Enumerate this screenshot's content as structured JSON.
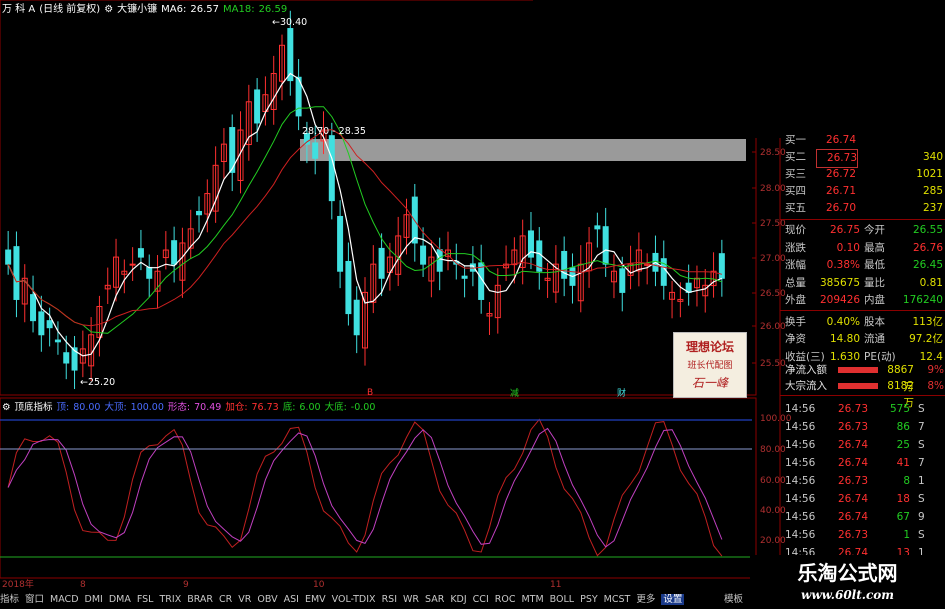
{
  "title_bar": {
    "stock": "万 科 A",
    "period": "(日线 前复权)",
    "indicator_name": "大镰小镰",
    "ma6_label": "MA6:",
    "ma6_value": "26.57",
    "ma18_label": "MA18:",
    "ma18_value": "26.59"
  },
  "price_annotations": {
    "high": "30.40",
    "low": "25.20",
    "range": "28.70 - 28.35"
  },
  "price_axis": [
    "28.50",
    "28.00",
    "27.50",
    "27.00",
    "26.50",
    "26.00",
    "25.50"
  ],
  "signal_marks": {
    "buy": "B",
    "reduce": "减",
    "fill": "财"
  },
  "indicator": {
    "name": "顶底指标",
    "ding_label": "顶:",
    "ding_value": "80.00",
    "da_label": "大顶:",
    "da_value": "100.00",
    "shili_label": "形态:",
    "shili_value": "70.49",
    "jiacang_label": "加仓:",
    "jiacang_value": "76.73",
    "di_label": "底:",
    "di_value": "6.00",
    "dadi_label": "大底:",
    "dadi_value": "-0.00",
    "axis": [
      "100.00",
      "80.00",
      "60.00",
      "40.00",
      "20.00"
    ]
  },
  "time_axis": [
    "2018年",
    "8",
    "9",
    "10",
    "11"
  ],
  "tabs": [
    "指标",
    "窗口",
    "MACD",
    "DMI",
    "DMA",
    "FSL",
    "TRIX",
    "BRAR",
    "CR",
    "VR",
    "OBV",
    "ASI",
    "EMV",
    "VOL-TDIX",
    "RSI",
    "WR",
    "SAR",
    "KDJ",
    "CCI",
    "ROC",
    "MTM",
    "BOLL",
    "PSY",
    "MCST",
    "更多",
    "设置"
  ],
  "active_tab": "设置",
  "bottom_right_tab": "模板",
  "bids": [
    {
      "label": "买一",
      "price": "26.74",
      "vol": "",
      "color": "#ff3030"
    },
    {
      "label": "买二",
      "price": "26.73",
      "vol": "340",
      "color": "#ff3030"
    },
    {
      "label": "买三",
      "price": "26.72",
      "vol": "1021",
      "color": "#ff3030"
    },
    {
      "label": "买四",
      "price": "26.71",
      "vol": "285",
      "color": "#ff3030"
    },
    {
      "label": "买五",
      "price": "26.70",
      "vol": "237",
      "color": "#ff3030"
    }
  ],
  "stats": [
    {
      "l1": "现价",
      "v1": "26.75",
      "c1": "#ff3030",
      "l2": "今开",
      "v2": "26.55",
      "c2": "#22cc22"
    },
    {
      "l1": "涨跌",
      "v1": "0.10",
      "c1": "#ff3030",
      "l2": "最高",
      "v2": "26.76",
      "c2": "#ff3030"
    },
    {
      "l1": "涨幅",
      "v1": "0.38%",
      "c1": "#ff3030",
      "l2": "最低",
      "v2": "26.45",
      "c2": "#22cc22"
    },
    {
      "l1": "总量",
      "v1": "385675",
      "c1": "#e0e000",
      "l2": "量比",
      "v2": "0.81",
      "c2": "#e0e000"
    },
    {
      "l1": "外盘",
      "v1": "209426",
      "c1": "#ff3030",
      "l2": "内盘",
      "v2": "176240",
      "c2": "#22cc22"
    },
    {
      "l1": "换手",
      "v1": "0.40%",
      "c1": "#e0e000",
      "l2": "股本",
      "v2": "113亿",
      "c2": "#e0e000"
    },
    {
      "l1": "净资",
      "v1": "14.80",
      "c1": "#e0e000",
      "l2": "流通",
      "v2": "97.2亿",
      "c2": "#e0e000"
    },
    {
      "l1": "收益(三)",
      "v1": "1.630",
      "c1": "#e0e000",
      "l2": "PE(动)",
      "v2": "12.4",
      "c2": "#e0e000"
    }
  ],
  "flows": [
    {
      "label": "净流入额",
      "value": "8867万",
      "pct": "9%"
    },
    {
      "label": "大宗流入",
      "value": "8182万",
      "pct": "8%"
    }
  ],
  "ticks": [
    {
      "time": "14:56",
      "price": "26.73",
      "vol": "575",
      "dir": "S",
      "pc": "#ff3030",
      "vc": "#22cc22"
    },
    {
      "time": "14:56",
      "price": "26.73",
      "vol": "86",
      "dir": "7",
      "pc": "#ff3030",
      "vc": "#22cc22"
    },
    {
      "time": "14:56",
      "price": "26.74",
      "vol": "25",
      "dir": "S",
      "pc": "#ff3030",
      "vc": "#22cc22"
    },
    {
      "time": "14:56",
      "price": "26.74",
      "vol": "41",
      "dir": "7",
      "pc": "#ff3030",
      "vc": "#ff3030"
    },
    {
      "time": "14:56",
      "price": "26.73",
      "vol": "8",
      "dir": "1",
      "pc": "#ff3030",
      "vc": "#22cc22"
    },
    {
      "time": "14:56",
      "price": "26.74",
      "vol": "18",
      "dir": "S",
      "pc": "#ff3030",
      "vc": "#ff3030"
    },
    {
      "time": "14:56",
      "price": "26.74",
      "vol": "67",
      "dir": "9",
      "pc": "#ff3030",
      "vc": "#22cc22"
    },
    {
      "time": "14:56",
      "price": "26.73",
      "vol": "1",
      "dir": "S",
      "pc": "#ff3030",
      "vc": "#22cc22"
    },
    {
      "time": "14:56",
      "price": "26.74",
      "vol": "13",
      "dir": "1",
      "pc": "#ff3030",
      "vc": "#ff3030"
    }
  ],
  "watermark": {
    "line1": "理想论坛",
    "line2": "班长代配图",
    "line3": "石一峰"
  },
  "site": {
    "name": "乐淘公式网",
    "url": "www.60lt.com"
  },
  "colors": {
    "up": "#ff3030",
    "down": "#40e0e0",
    "ma_white": "#ffffff",
    "ma_green": "#22cc22",
    "ma_red": "#cc2020",
    "grid": "#8b0000",
    "ind_magenta": "#c040c0",
    "ind_red": "#c02020"
  }
}
